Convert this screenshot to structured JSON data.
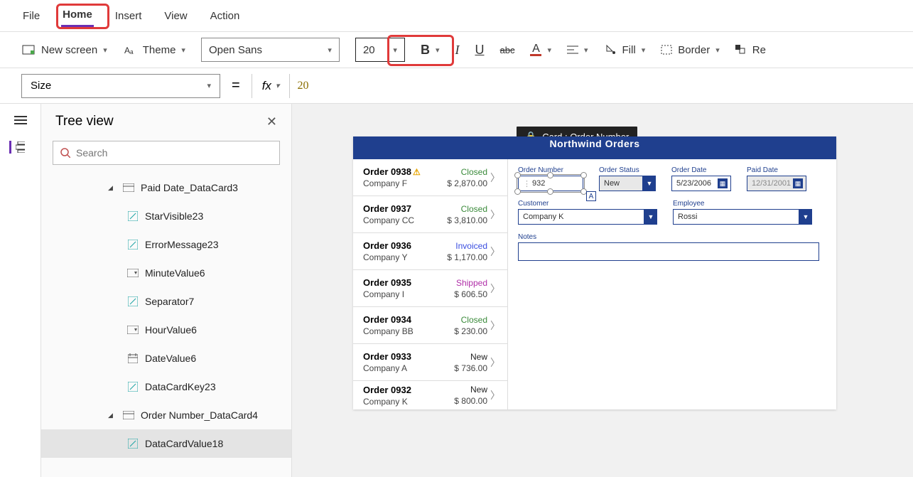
{
  "menu": {
    "file": "File",
    "home": "Home",
    "insert": "Insert",
    "view": "View",
    "action": "Action"
  },
  "ribbon": {
    "newscreen": "New screen",
    "theme": "Theme",
    "font": "Open Sans",
    "fontsize": "20",
    "fill": "Fill",
    "border": "Border",
    "lastcut": "Re"
  },
  "formula": {
    "property": "Size",
    "fx": "fx",
    "value": "20"
  },
  "tree": {
    "title": "Tree view",
    "search_placeholder": "Search",
    "nodes": {
      "paidcard": "Paid Date_DataCard3",
      "starvisible": "StarVisible23",
      "errmsg": "ErrorMessage23",
      "minute": "MinuteValue6",
      "sep": "Separator7",
      "hour": "HourValue6",
      "date": "DateValue6",
      "key": "DataCardKey23",
      "ordercard": "Order Number_DataCard4",
      "dcv": "DataCardValue18"
    }
  },
  "tooltip": "Card : Order Number",
  "app": {
    "title": "Northwind Orders",
    "orders": [
      {
        "id": "Order 0938",
        "warn": true,
        "company": "Company F",
        "status": "Closed",
        "amount": "$ 2,870.00"
      },
      {
        "id": "Order 0937",
        "warn": false,
        "company": "Company CC",
        "status": "Closed",
        "amount": "$ 3,810.00"
      },
      {
        "id": "Order 0936",
        "warn": false,
        "company": "Company Y",
        "status": "Invoiced",
        "amount": "$ 1,170.00"
      },
      {
        "id": "Order 0935",
        "warn": false,
        "company": "Company I",
        "status": "Shipped",
        "amount": "$ 606.50"
      },
      {
        "id": "Order 0934",
        "warn": false,
        "company": "Company BB",
        "status": "Closed",
        "amount": "$ 230.00"
      },
      {
        "id": "Order 0933",
        "warn": false,
        "company": "Company A",
        "status": "New",
        "amount": "$ 736.00"
      },
      {
        "id": "Order 0932",
        "warn": false,
        "company": "Company K",
        "status": "New",
        "amount": "$ 800.00"
      }
    ],
    "form": {
      "labels": {
        "ordernum": "Order Number",
        "status": "Order Status",
        "orderdate": "Order Date",
        "paiddate": "Paid Date",
        "customer": "Customer",
        "employee": "Employee",
        "notes": "Notes"
      },
      "values": {
        "ordernum": "932",
        "status": "New",
        "orderdate": "5/23/2006",
        "paiddate": "12/31/2001",
        "customer": "Company K",
        "employee": "Rossi",
        "notes": ""
      }
    }
  }
}
